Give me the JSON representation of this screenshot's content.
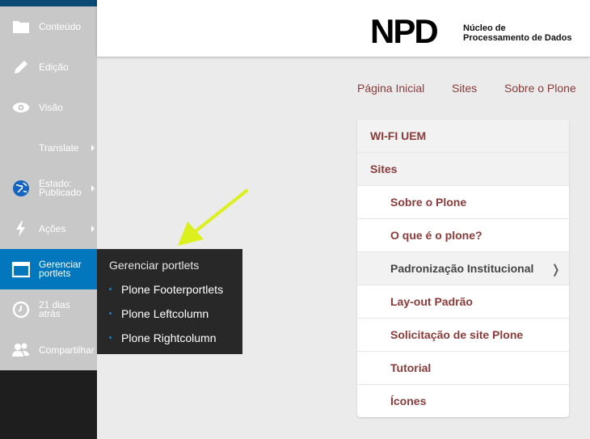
{
  "toolbar": {
    "items": [
      {
        "label": "Conteúdo",
        "icon": "folder-icon"
      },
      {
        "label": "Edição",
        "icon": "pencil-icon"
      },
      {
        "label": "Visão",
        "icon": "eye-icon"
      },
      {
        "label": "Translate",
        "icon": "",
        "has_arrow": true
      },
      {
        "label_line1": "Estado:",
        "label_line2": "Publicado",
        "icon": "globe-icon",
        "has_arrow": true
      },
      {
        "label": "Ações",
        "icon": "bolt-icon",
        "has_arrow": true
      },
      {
        "label_line1": "Gerenciar",
        "label_line2": "portlets",
        "icon": "portlet-icon",
        "active": true
      },
      {
        "label_line1": "21 dias",
        "label_line2": "atrás",
        "icon": "clock-icon"
      },
      {
        "label": "Compartilhar",
        "icon": "users-icon"
      }
    ]
  },
  "submenu": {
    "title": "Gerenciar portlets",
    "items": [
      "Plone Footerportlets",
      "Plone Leftcolumn",
      "Plone Rightcolumn"
    ]
  },
  "logo": {
    "text": "NPD",
    "sub_line1": "Núcleo de",
    "sub_line2": "Processamento de Dados"
  },
  "topnav": [
    "Página Inicial",
    "Sites",
    "Sobre o Plone"
  ],
  "navigation": {
    "items": [
      {
        "label": "WI-FI UEM",
        "level": 0
      },
      {
        "label": "Sites",
        "level": 0
      },
      {
        "label": "Sobre o Plone",
        "level": 1
      },
      {
        "label": "O que é o plone?",
        "level": 1
      },
      {
        "label": "Padronização Institucional",
        "level": 1,
        "current": true,
        "chevron": "❭"
      },
      {
        "label": "Lay-out Padrão",
        "level": 1
      },
      {
        "label": "Solicitação de site Plone",
        "level": 1
      },
      {
        "label": "Tutorial",
        "level": 1
      },
      {
        "label": "Ícones",
        "level": 1
      }
    ]
  },
  "colors": {
    "toolbar_blue": "#0277bd",
    "link_color": "#8b3a3a",
    "arrow_color": "#dcf01e"
  }
}
